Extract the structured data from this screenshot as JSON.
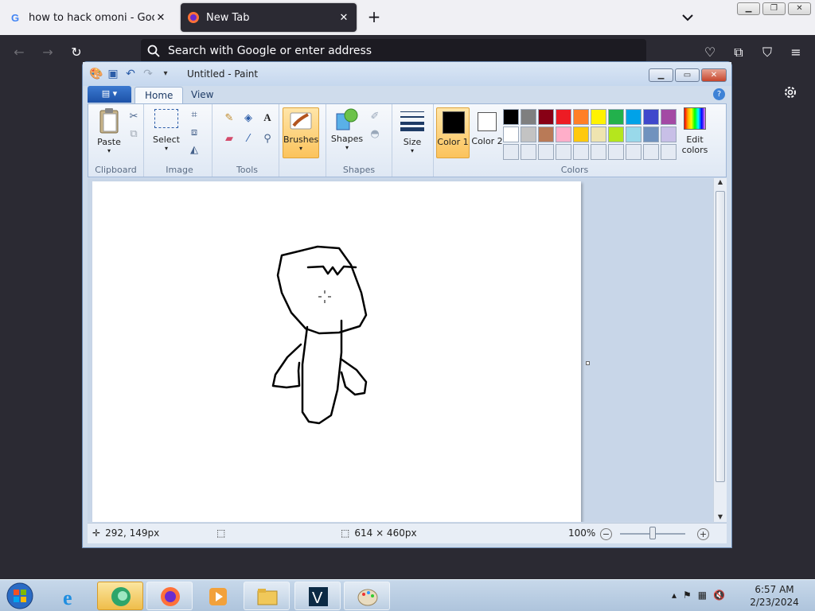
{
  "browser": {
    "tabs": [
      {
        "label": "how to hack omoni - Google Search",
        "icon": "google-icon"
      },
      {
        "label": "New Tab",
        "icon": "firefox-icon"
      }
    ],
    "address_placeholder": "Search with Google or enter address"
  },
  "paint": {
    "title": "Untitled - Paint",
    "ribbon_tabs": [
      "Home",
      "View"
    ],
    "groups": {
      "clipboard": "Clipboard",
      "image": "Image",
      "tools": "Tools",
      "shapes": "Shapes",
      "colors": "Colors"
    },
    "buttons": {
      "paste": "Paste",
      "select": "Select",
      "brushes": "Brushes",
      "shapes": "Shapes",
      "size": "Size",
      "color1": "Color 1",
      "color2": "Color 2",
      "edit_colors": "Edit colors"
    },
    "color1_value": "#000000",
    "color2_value": "#ffffff",
    "palette": [
      "#000000",
      "#7f7f7f",
      "#880015",
      "#ed1c24",
      "#ff7f27",
      "#fff200",
      "#22b14c",
      "#00a2e8",
      "#3f48cc",
      "#a349a4",
      "#ffffff",
      "#c3c3c3",
      "#b97a57",
      "#ffaec9",
      "#ffc90e",
      "#efe4b0",
      "#b5e61d",
      "#99d9ea",
      "#7092be",
      "#c8bfe7",
      "#e4eaf3",
      "#e4eaf3",
      "#e4eaf3",
      "#e4eaf3",
      "#e4eaf3",
      "#e4eaf3",
      "#e4eaf3",
      "#e4eaf3",
      "#e4eaf3",
      "#e4eaf3"
    ],
    "status": {
      "cursor_pos": "292, 149px",
      "canvas_size": "614 × 460px",
      "zoom": "100%"
    }
  },
  "taskbar": {
    "time": "6:57 AM",
    "date": "2/23/2024"
  }
}
